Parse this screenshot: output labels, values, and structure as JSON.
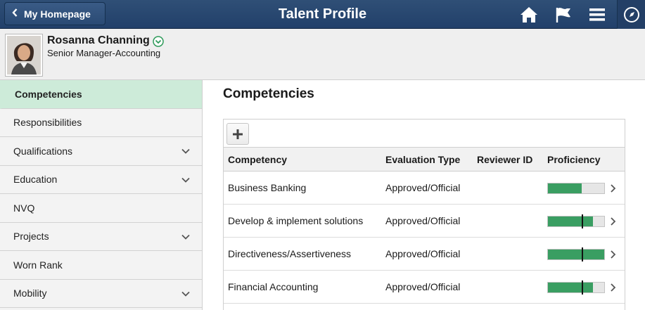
{
  "banner": {
    "home_button": "My Homepage",
    "title": "Talent Profile",
    "icons": [
      "home-icon",
      "flag-icon",
      "menu-icon",
      "navbar-icon"
    ],
    "background_color": "#22406a"
  },
  "profile": {
    "name": "Rosanna Channing",
    "job_title": "Senior Manager-Accounting"
  },
  "sidebar": {
    "items": [
      {
        "label": "Competencies",
        "active": true,
        "expandable": false
      },
      {
        "label": "Responsibilities",
        "active": false,
        "expandable": false
      },
      {
        "label": "Qualifications",
        "active": false,
        "expandable": true
      },
      {
        "label": "Education",
        "active": false,
        "expandable": true
      },
      {
        "label": "NVQ",
        "active": false,
        "expandable": false
      },
      {
        "label": "Projects",
        "active": false,
        "expandable": true
      },
      {
        "label": "Worn Rank",
        "active": false,
        "expandable": false
      },
      {
        "label": "Mobility",
        "active": false,
        "expandable": true
      }
    ],
    "active_color": "#cdebd9"
  },
  "main": {
    "title": "Competencies",
    "columns": [
      "Competency",
      "Evaluation Type",
      "Reviewer ID",
      "Proficiency"
    ],
    "rows": [
      {
        "competency": "Business Banking",
        "evaluation_type": "Approved/Official",
        "reviewer_id": "",
        "proficiency": 0.6,
        "target": null
      },
      {
        "competency": "Develop & implement solutions",
        "evaluation_type": "Approved/Official",
        "reviewer_id": "",
        "proficiency": 0.8,
        "target": 0.6
      },
      {
        "competency": "Directiveness/Assertiveness",
        "evaluation_type": "Approved/Official",
        "reviewer_id": "",
        "proficiency": 1.0,
        "target": 0.6
      },
      {
        "competency": "Financial Accounting",
        "evaluation_type": "Approved/Official",
        "reviewer_id": "",
        "proficiency": 0.8,
        "target": 0.6
      }
    ],
    "proficiency_color": "#3a9e62"
  }
}
